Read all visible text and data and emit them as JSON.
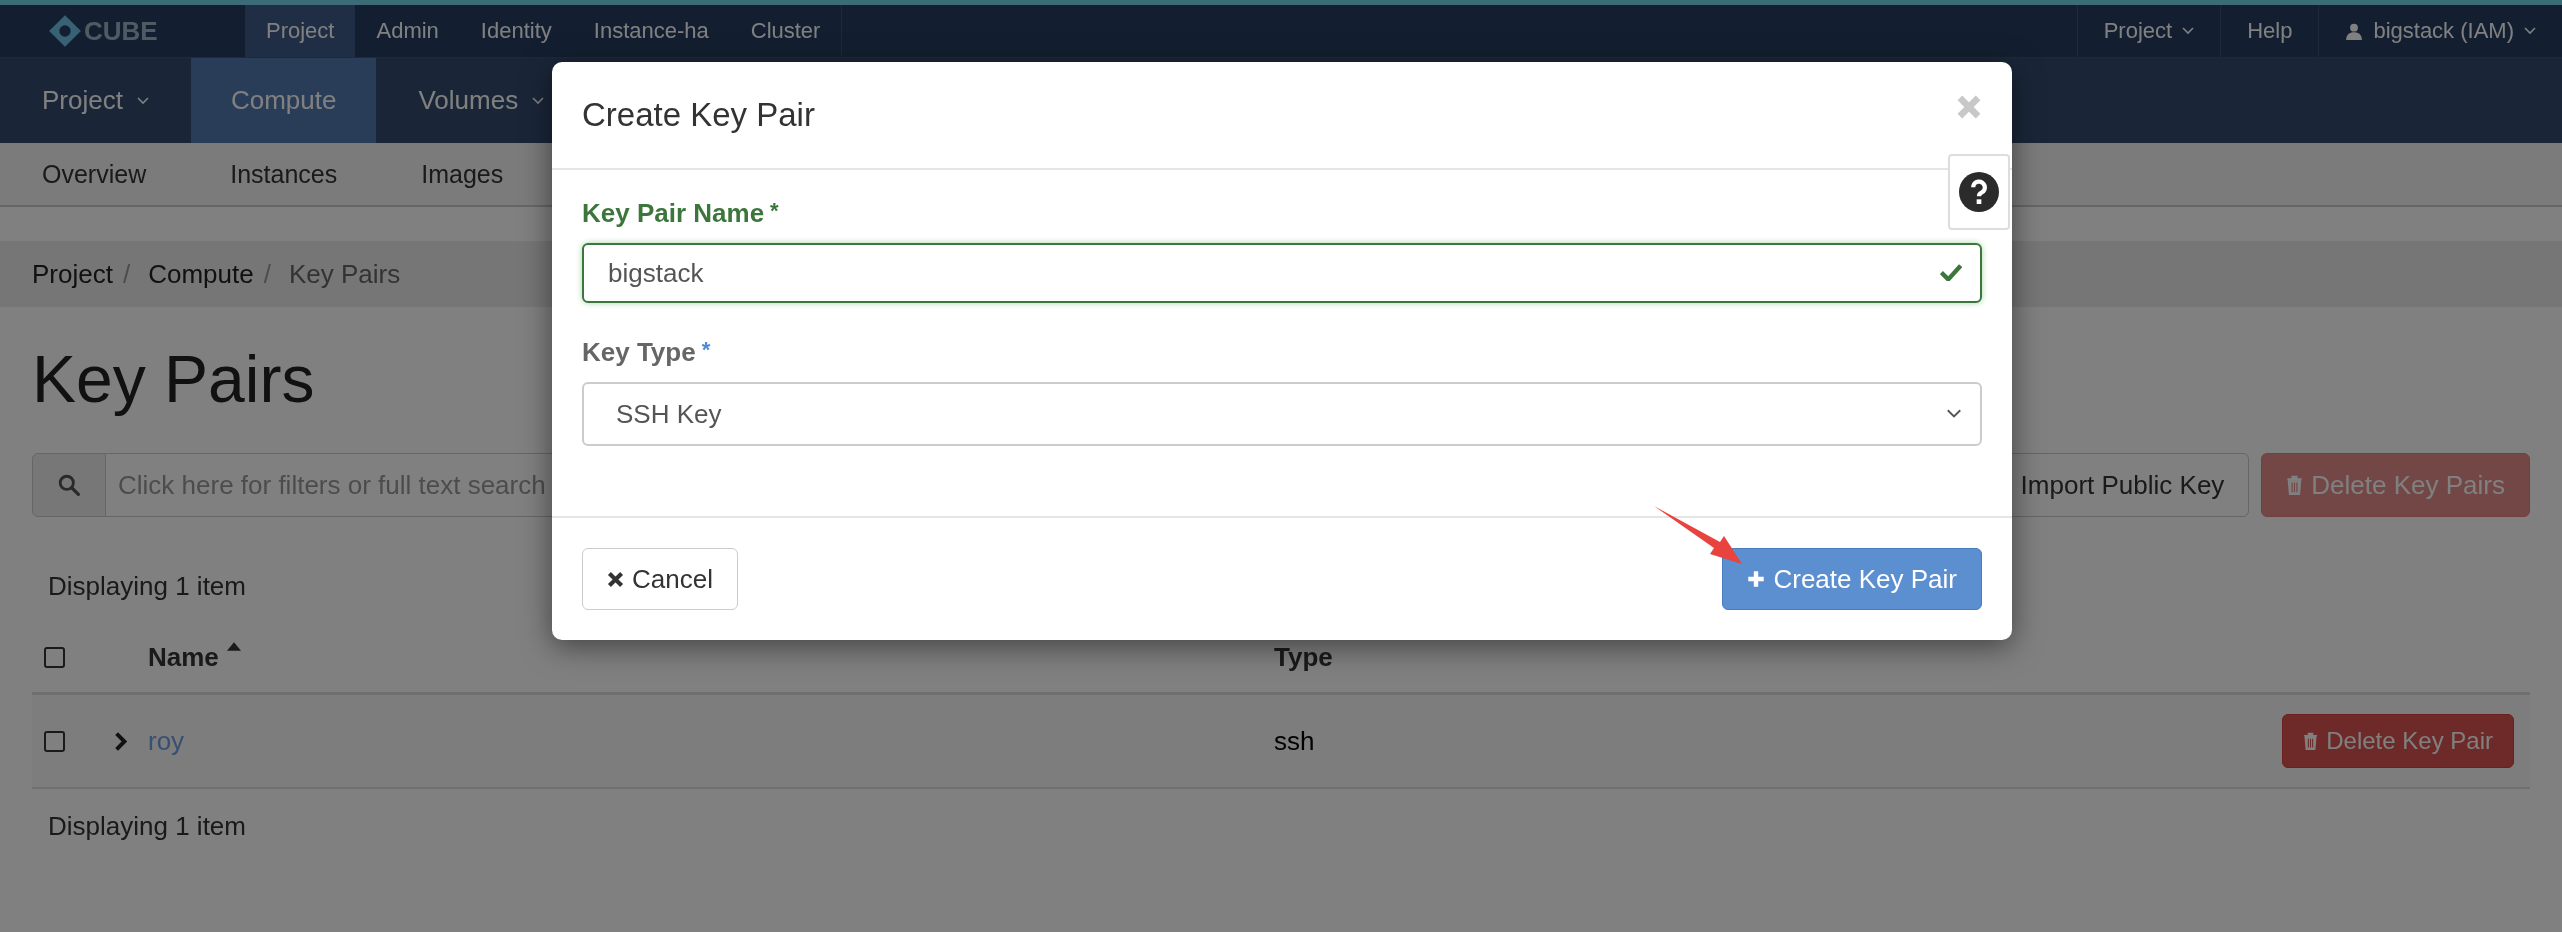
{
  "top_nav": {
    "logo": "CUBE",
    "items": [
      {
        "label": "Project",
        "selected": true
      },
      {
        "label": "Admin",
        "selected": false
      },
      {
        "label": "Identity",
        "selected": false
      },
      {
        "label": "Instance-ha",
        "selected": false
      },
      {
        "label": "Cluster",
        "selected": false
      }
    ],
    "right_items": [
      {
        "label": "Project",
        "kind": "dropdown"
      },
      {
        "label": "Help",
        "kind": "link"
      },
      {
        "label": "bigstack (IAM)",
        "kind": "user"
      }
    ]
  },
  "main_nav": {
    "items": [
      {
        "label": "Project",
        "selected": false,
        "dropdown": true
      },
      {
        "label": "Compute",
        "selected": true,
        "dropdown": false
      },
      {
        "label": "Volumes",
        "selected": false,
        "dropdown": true
      }
    ]
  },
  "sub_nav": {
    "items": [
      {
        "label": "Overview"
      },
      {
        "label": "Instances"
      },
      {
        "label": "Images"
      }
    ]
  },
  "breadcrumb": {
    "separator": "/",
    "items": [
      "Project",
      "Compute",
      "Key Pairs"
    ]
  },
  "page_title": "Key Pairs",
  "search": {
    "placeholder": "Click here for filters or full text search"
  },
  "actions": [
    {
      "label": "Import Public Key",
      "kind": "default",
      "disabled": false
    },
    {
      "label": "Delete Key Pairs",
      "kind": "danger",
      "disabled": true
    }
  ],
  "count_top": "Displaying 1 item",
  "table": {
    "select_all": {
      "checked": false
    },
    "columns": [
      {
        "label": "Name",
        "sorted_ascending": true
      },
      {
        "label": "Type"
      }
    ],
    "rows": [
      {
        "checked": false,
        "expanded": false,
        "name": "roy",
        "type": "ssh",
        "action": "Delete Key Pair"
      }
    ]
  },
  "count_bottom": "Displaying 1 item",
  "dialog": {
    "title": "Create Key Pair",
    "fields": [
      {
        "label": "Key Pair Name",
        "required_mark": "*",
        "kind": "text",
        "value": "bigstack",
        "valid": true
      },
      {
        "label": "Key Type",
        "required_mark": "*",
        "kind": "select",
        "value": "SSH Key",
        "valid": false
      }
    ],
    "buttons": [
      {
        "label": "Cancel",
        "kind": "default"
      },
      {
        "label": "Create Key Pair",
        "kind": "primary"
      }
    ]
  }
}
